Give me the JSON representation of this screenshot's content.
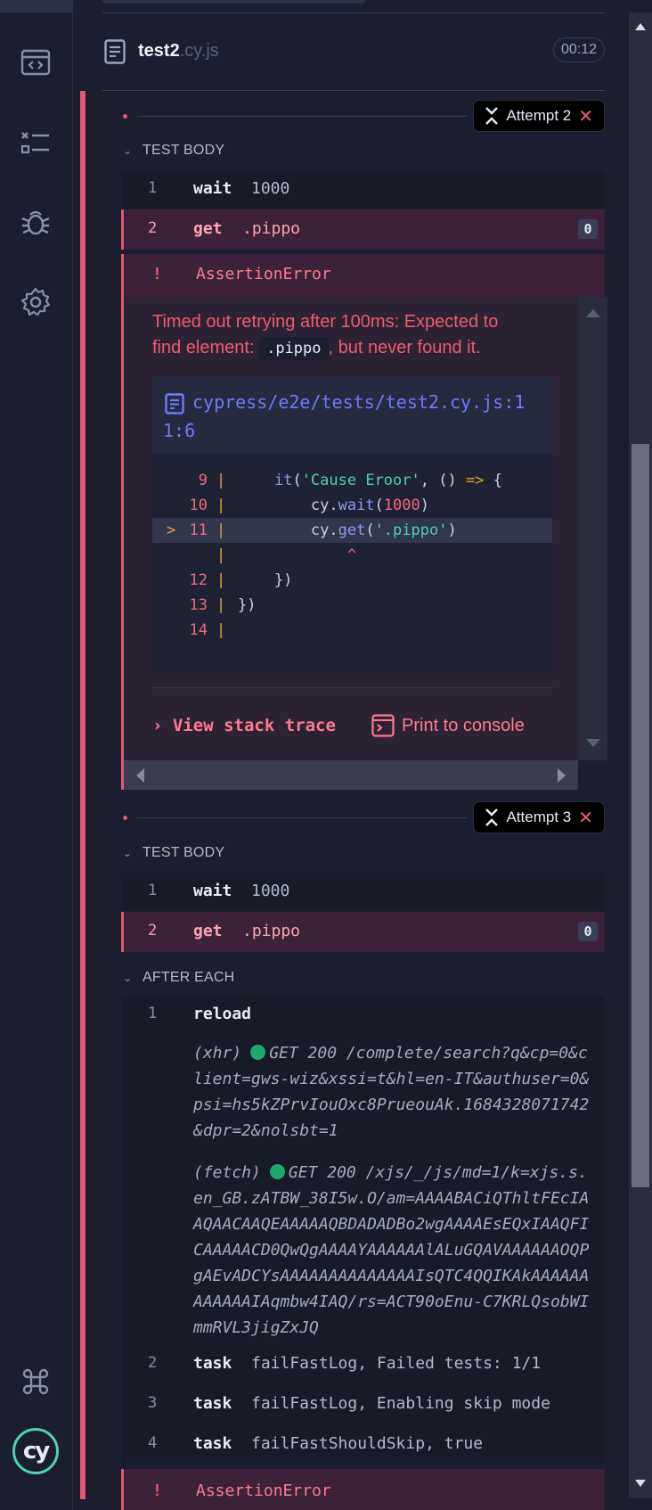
{
  "spec": {
    "name": "test2",
    "ext": ".cy.js",
    "duration": "00:12"
  },
  "attempt2": {
    "badge": "Attempt 2",
    "section": "TEST BODY",
    "commands": [
      {
        "num": "1",
        "name": "wait",
        "arg": "1000"
      },
      {
        "num": "2",
        "name": "get",
        "arg": ".pippo",
        "count": "0"
      }
    ],
    "error": {
      "bang": "!",
      "title": "AssertionError",
      "msg_before": "Timed out retrying after 100ms: Expected to find element: ",
      "msg_code": ".pippo",
      "msg_after": ", but never found it.",
      "file_path": "cypress/e2e/tests/test2.cy.js:11:6",
      "code_frame": [
        {
          "ln": "9",
          "text": "    it('Cause Eroor', () => {"
        },
        {
          "ln": "10",
          "text": "        cy.wait(1000)"
        },
        {
          "ln": "11",
          "text": "        cy.get('.pippo')",
          "marker": ">"
        },
        {
          "ln": "",
          "text": "            ^"
        },
        {
          "ln": "12",
          "text": "    })"
        },
        {
          "ln": "13",
          "text": "})"
        },
        {
          "ln": "14",
          "text": ""
        }
      ],
      "stack_label": "View stack trace",
      "print_label": "Print to console"
    }
  },
  "attempt3": {
    "badge": "Attempt 3",
    "section": "TEST BODY",
    "commands": [
      {
        "num": "1",
        "name": "wait",
        "arg": "1000"
      },
      {
        "num": "2",
        "name": "get",
        "arg": ".pippo",
        "count": "0"
      }
    ],
    "after_each": {
      "label": "AFTER EACH",
      "reload": {
        "num": "1",
        "name": "reload"
      },
      "xhr": {
        "type": "(xhr)",
        "text": "GET 200 /complete/search?q&cp=0&client=gws-wiz&xssi=t&hl=en-IT&authuser=0&psi=hs5kZPrvIouOxc8PrueouAk.1684328071742&dpr=2&nolsbt=1"
      },
      "fetch": {
        "type": "(fetch)",
        "text": "GET 200 /xjs/_/js/md=1/k=xjs.s.en_GB.zATBW_38I5w.O/am=AAAABACiQThltFEcIAAQAACAAQEAAAAAQBDADADBo2wgAAAAEsEQxIAAQFICAAAAACD0QwQgAAAAYAAAAAAlALuGQAVAAAAAAOQPgAEvADCYsAAAAAAAAAAAAAAIsQTC4QQIKAkAAAAAAAAAAAAIAqmbw4IAQ/rs=ACT90oEnu-C7KRLQsobWImmRVL3jigZxJQ"
      },
      "tasks": [
        {
          "num": "2",
          "name": "task",
          "arg": "failFastLog, Failed tests: 1/1"
        },
        {
          "num": "3",
          "name": "task",
          "arg": "failFastLog, Enabling skip mode"
        },
        {
          "num": "4",
          "name": "task",
          "arg": "failFastShouldSkip, true"
        }
      ]
    },
    "error": {
      "bang": "!",
      "title": "AssertionError"
    }
  },
  "icons": {
    "nav": [
      "specs-icon",
      "runs-icon",
      "debug-icon",
      "settings-icon",
      "keyboard-shortcuts-icon"
    ],
    "accent_fail": "#e45770",
    "accent_logo": "#4fd1b2"
  }
}
